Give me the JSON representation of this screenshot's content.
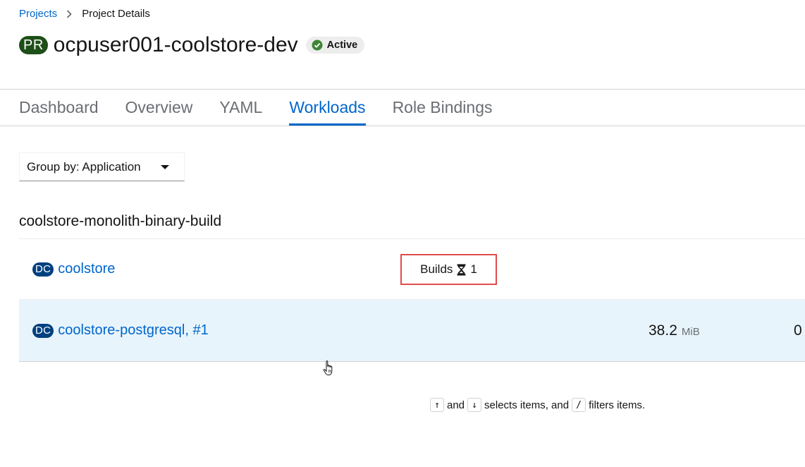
{
  "breadcrumb": {
    "link_label": "Projects",
    "current_label": "Project Details"
  },
  "project": {
    "badge": "PR",
    "name": "ocpuser001-coolstore-dev",
    "status": "Active"
  },
  "tabs": [
    {
      "label": "Dashboard",
      "active": false
    },
    {
      "label": "Overview",
      "active": false
    },
    {
      "label": "YAML",
      "active": false
    },
    {
      "label": "Workloads",
      "active": true
    },
    {
      "label": "Role Bindings",
      "active": false
    }
  ],
  "groupby": {
    "label": "Group by: Application"
  },
  "group": {
    "heading": "coolstore-monolith-binary-build",
    "rows": [
      {
        "badge": "DC",
        "name": "coolstore",
        "builds_label": "Builds",
        "builds_count": "1"
      },
      {
        "badge": "DC",
        "name": "coolstore-postgresql",
        "separator": ",",
        "revision": "#1",
        "memory_value": "38.2",
        "memory_unit": "MiB",
        "cpu_partial": "0"
      }
    ]
  },
  "hint": {
    "key_up": "↑",
    "and": "and",
    "key_down": "↓",
    "selects": "selects items, and",
    "key_slash": "/",
    "filters": "filters items."
  },
  "colors": {
    "link": "#0066cc",
    "project_badge": "#1e4f18",
    "dc_badge": "#004080",
    "status_check": "#3e8635",
    "highlight_border": "#e04b4b",
    "selected_row": "#e8f4fc"
  }
}
